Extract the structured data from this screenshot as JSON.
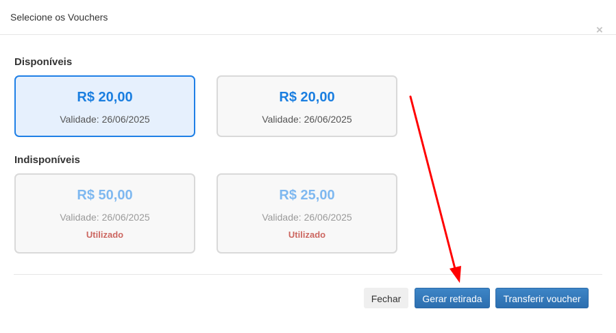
{
  "modal": {
    "title": "Selecione os Vouchers",
    "close_symbol": "×"
  },
  "sections": {
    "available_title": "Disponíveis",
    "unavailable_title": "Indisponíveis"
  },
  "available_vouchers": [
    {
      "amount": "R$ 20,00",
      "validity": "Validade: 26/06/2025",
      "selected": true
    },
    {
      "amount": "R$ 20,00",
      "validity": "Validade: 26/06/2025",
      "selected": false
    }
  ],
  "unavailable_vouchers": [
    {
      "amount": "R$ 50,00",
      "validity": "Validade: 26/06/2025",
      "status": "Utilizado"
    },
    {
      "amount": "R$ 25,00",
      "validity": "Validade: 26/06/2025",
      "status": "Utilizado"
    }
  ],
  "footer": {
    "close_label": "Fechar",
    "generate_label": "Gerar retirada",
    "transfer_label": "Transferir voucher"
  },
  "colors": {
    "accent_blue": "#1a7ee0",
    "selected_border": "#1e7fe6",
    "status_red": "#cc6660",
    "annotation_arrow": "#ff0000"
  },
  "icons": {
    "close": "close-icon",
    "annotation": "red-arrow-annotation-icon"
  }
}
